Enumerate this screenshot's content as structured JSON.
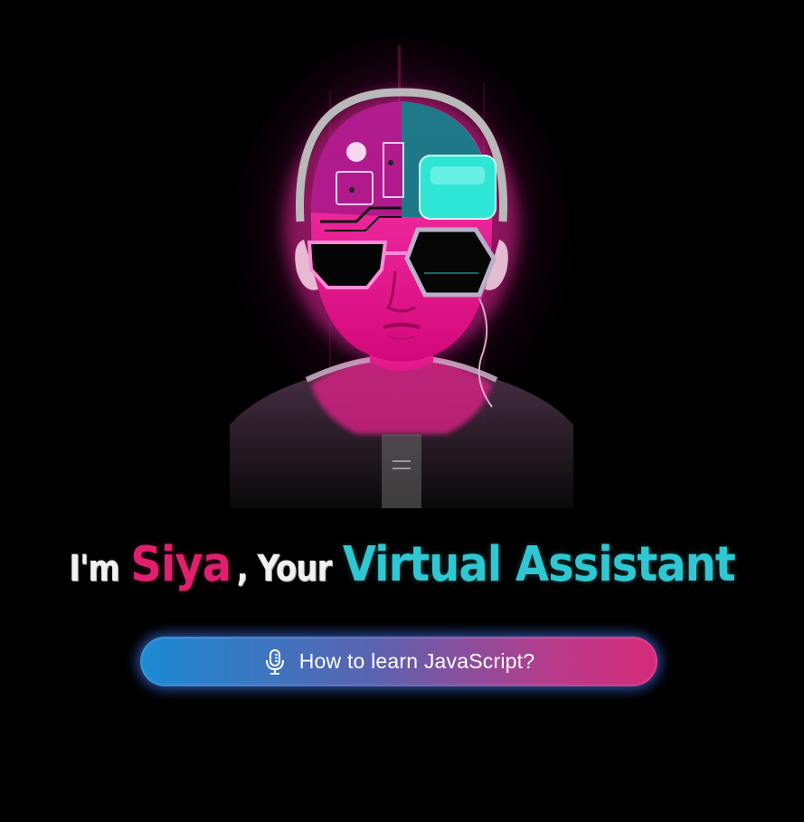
{
  "headline": {
    "prefix": "I'm",
    "name": "Siya",
    "middle": ", Your",
    "accent": "Virtual Assistant"
  },
  "voice_button": {
    "label": "How to learn JavaScript?",
    "icon": "microphone-icon"
  },
  "colors": {
    "background": "#000000",
    "name_pink": "#e0206e",
    "accent_cyan": "#2fc8d2",
    "button_start": "#1b8bd3",
    "button_end": "#d62a78"
  },
  "avatar": {
    "icon": "neon-robot-avatar"
  }
}
